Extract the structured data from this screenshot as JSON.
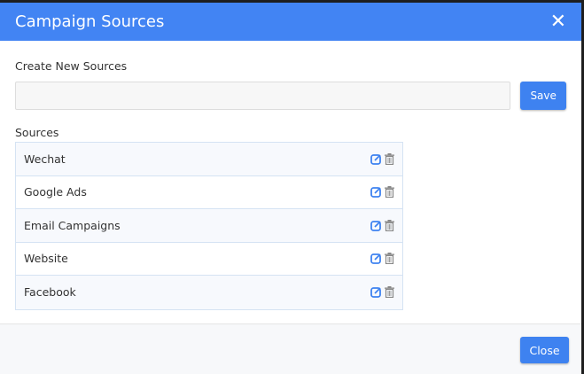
{
  "dialog": {
    "title": "Campaign Sources",
    "close_icon": "close-icon"
  },
  "create": {
    "label": "Create New Sources",
    "input_value": "",
    "save_label": "Save"
  },
  "sources": {
    "label": "Sources",
    "items": [
      {
        "name": "Wechat"
      },
      {
        "name": "Google Ads"
      },
      {
        "name": "Email Campaigns"
      },
      {
        "name": "Website"
      },
      {
        "name": "Facebook"
      }
    ]
  },
  "footer": {
    "close_label": "Close"
  },
  "colors": {
    "accent": "#4284f3",
    "edit": "#3e82f0",
    "delete": "#888888"
  }
}
